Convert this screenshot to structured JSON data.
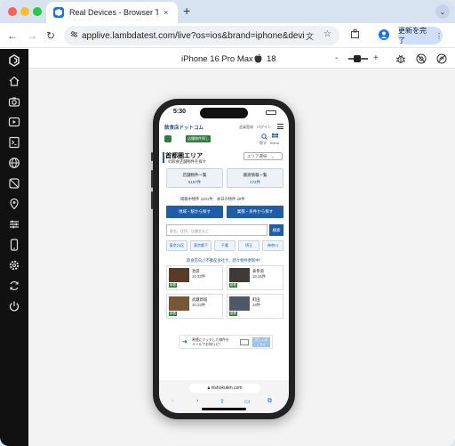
{
  "browser": {
    "tab_title": "Real Devices - Browser Testin",
    "tab_close": "×",
    "new_tab": "+",
    "tab_menu": "⌄",
    "url": "applive.lambdatest.com/live?os=ios&brand=iphone&devi...",
    "update_label": "更新を完了",
    "update_more": "⋮",
    "back": "←",
    "forward": "→",
    "reload": "↻"
  },
  "device": {
    "name": "iPhone 16 Pro Max",
    "os_icon": "apple-icon",
    "os_version": "18",
    "zoom_minus": "-",
    "zoom_plus": "+"
  },
  "phone": {
    "time": "5:30",
    "site": {
      "logo": "飲食店ドットコム",
      "header_links": "会員登録　ログイン",
      "nav_badge": "店舗物件探し",
      "search_label": "探す",
      "menu_label": "menu",
      "area_title": "首都圏エリア",
      "area_sub": "の飲食店舗物件を探す",
      "area_select": "エリア選択　⌄",
      "box1_label": "店舗物件一覧",
      "box1_count": "5167件",
      "box2_label": "譲渡情報一覧",
      "box2_count": "172件",
      "counts": "掲載中物件 2201件　本日の物件 28件",
      "btn_area": "地域・駅から探す",
      "btn_cond": "業態・条件から探す",
      "search_placeholder": "駅名、住所、店舗名など",
      "search_btn": "検索",
      "chips": [
        "東京23区",
        "東京都下",
        "千葉",
        "埼玉",
        "神奈川"
      ],
      "promo": "飲食店向け不動産会社が、続々物件更新中！",
      "cards": [
        {
          "name": "池袋",
          "count": "10,33件",
          "tag": "新着"
        },
        {
          "name": "表参道",
          "count": "18,15件",
          "tag": "新着"
        },
        {
          "name": "武蔵新城",
          "count": "10,23件",
          "tag": "新着"
        },
        {
          "name": "町田",
          "count": "18件",
          "tag": "新着"
        }
      ],
      "mail_text": "希望にマッチした物件を\nメールでお知らせ！",
      "mail_btn": "詳しくは\nこちら"
    },
    "url_bar": "inshokuten.com",
    "bottom_icons": [
      "‹",
      "›",
      "⇧",
      "▭",
      "⧉"
    ]
  },
  "sidebar": {
    "items": [
      "logo-icon",
      "home-icon",
      "camera-icon",
      "video-icon",
      "terminal-icon",
      "globe-icon",
      "wifi-off-icon",
      "location-icon",
      "settings-sliders-icon",
      "device-icon",
      "gear-icon",
      "switch-icon",
      "power-icon"
    ]
  }
}
